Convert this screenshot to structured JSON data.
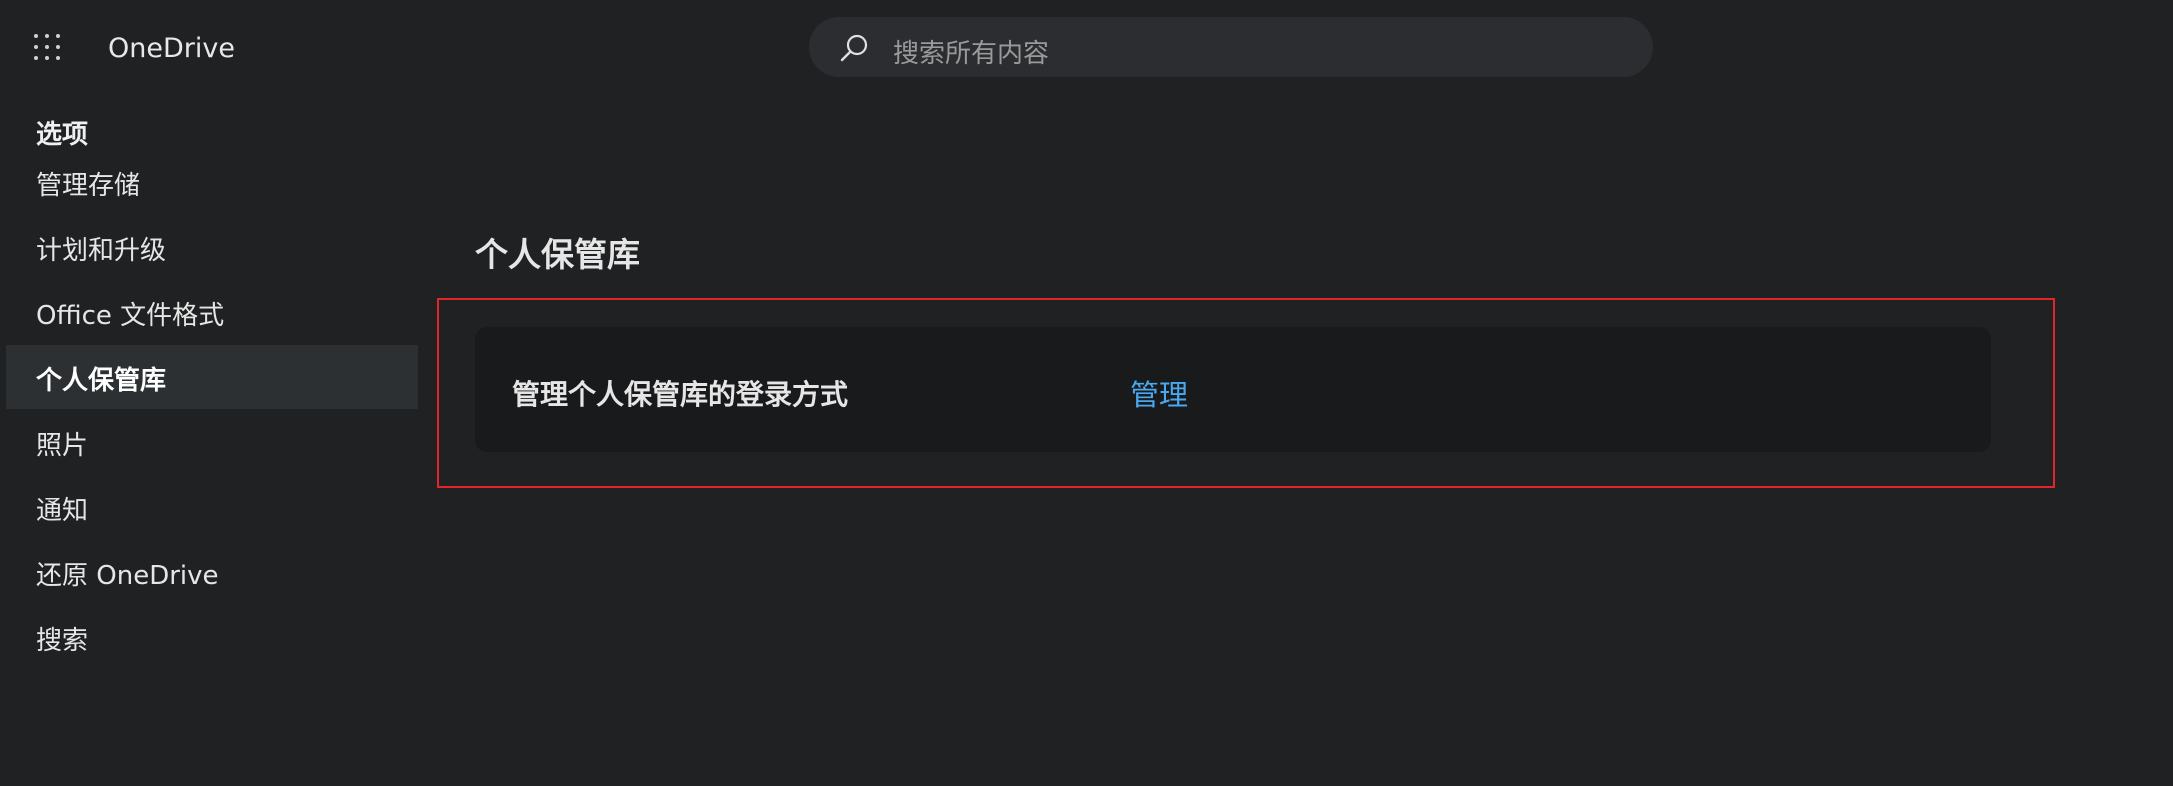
{
  "app": {
    "title": "OneDrive"
  },
  "search": {
    "placeholder": "搜索所有内容"
  },
  "sidebar": {
    "heading": "选项",
    "items": [
      {
        "label": "管理存储"
      },
      {
        "label": "计划和升级"
      },
      {
        "label": "Office 文件格式"
      },
      {
        "label": "个人保管库",
        "selected": true
      },
      {
        "label": "照片"
      },
      {
        "label": "通知"
      },
      {
        "label": "还原 OneDrive"
      },
      {
        "label": "搜索"
      }
    ]
  },
  "main": {
    "section_title": "个人保管库",
    "card": {
      "label": "管理个人保管库的登录方式",
      "link": "管理"
    }
  },
  "colors": {
    "background": "#1f2123",
    "selected_item": "#2d3033",
    "card": "#191a1c",
    "link": "#4aa8f0",
    "highlight": "#e2252b"
  },
  "icons": [
    "app-launcher-icon",
    "search-icon"
  ]
}
